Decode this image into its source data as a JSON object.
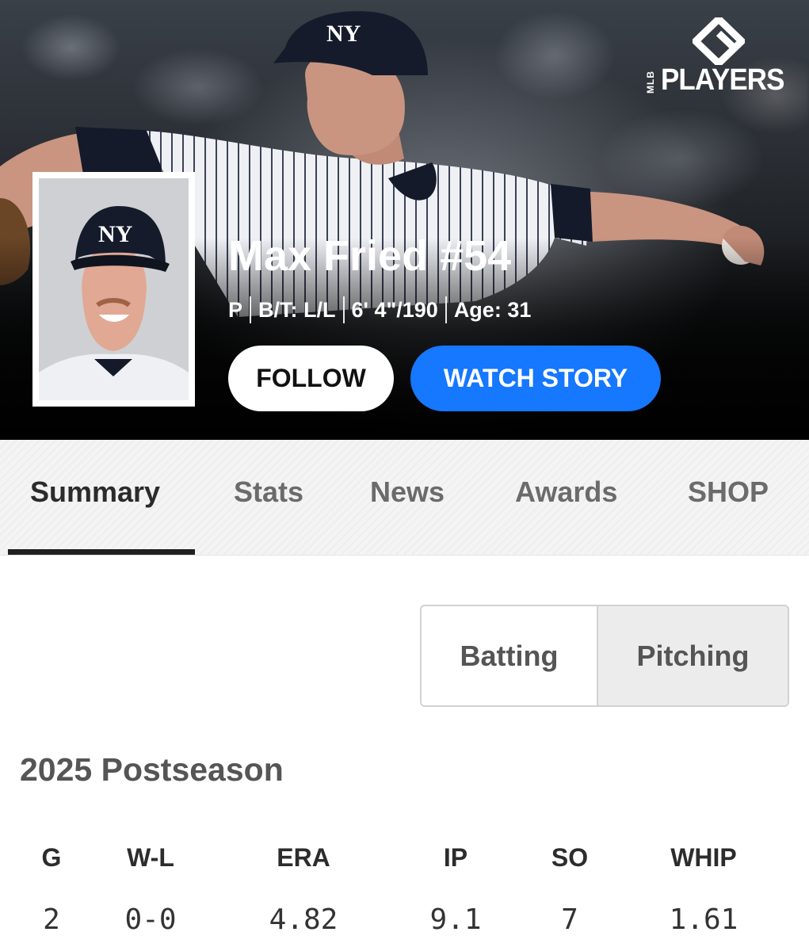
{
  "brand": {
    "logo_text": "PLAYERS",
    "logo_small": "MLB"
  },
  "player": {
    "name": "Max Fried #54",
    "meta": [
      "P",
      "B/T: L/L",
      "6' 4\"/190",
      "Age: 31"
    ]
  },
  "actions": {
    "follow": "FOLLOW",
    "watch": "WATCH STORY"
  },
  "tabs": [
    {
      "label": "Summary",
      "active": true
    },
    {
      "label": "Stats"
    },
    {
      "label": "News"
    },
    {
      "label": "Awards"
    },
    {
      "label": "SHOP"
    }
  ],
  "toggle": {
    "batting": "Batting",
    "pitching": "Pitching",
    "selected": "Pitching"
  },
  "section": {
    "title": "2025 Postseason"
  },
  "stats": {
    "headers": [
      "G",
      "W-L",
      "ERA",
      "IP",
      "SO",
      "WHIP"
    ],
    "values": [
      "2",
      "0-0",
      "4.82",
      "9.1",
      "7",
      "1.61"
    ]
  },
  "colors": {
    "accent_blue": "#1677ff",
    "hero_bg": "#000000",
    "tab_bg": "#f4f4f5"
  }
}
